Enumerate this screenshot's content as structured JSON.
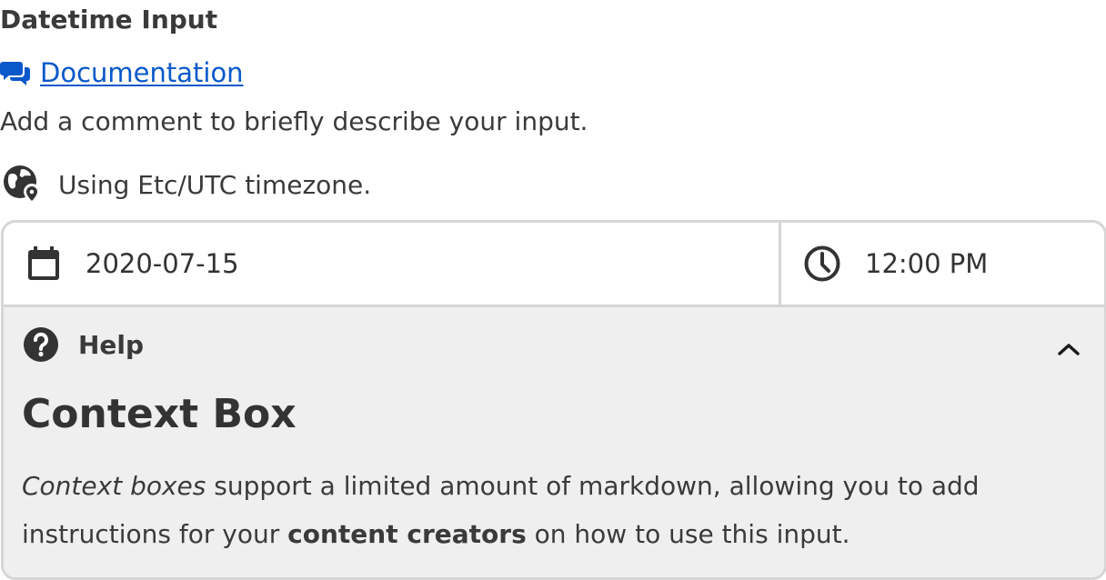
{
  "field": {
    "title": "Datetime Input",
    "documentation_link": "Documentation",
    "comment": "Add a comment to briefly describe your input.",
    "timezone_note": "Using Etc/UTC timezone."
  },
  "inputs": {
    "date_value": "2020-07-15",
    "time_value": "12:00 PM"
  },
  "help": {
    "label": "Help",
    "expanded": true,
    "context_title": "Context Box",
    "body": {
      "em_text": "Context boxes",
      "text_1": " support a limited amount of markdown, allowing you to add instructions for your ",
      "strong_text": "content creators",
      "text_2": " on how to use this input."
    }
  },
  "icons": {
    "documentation": "chat-bubbles-icon",
    "timezone": "globe-pin-icon",
    "date": "calendar-icon",
    "time": "clock-icon",
    "help": "question-circle-icon",
    "collapse": "chevron-up-icon"
  },
  "colors": {
    "link": "#0a58ca",
    "text": "#333333",
    "border": "#d6d6d6",
    "panel_background": "#efefef",
    "icon": "#333333"
  }
}
